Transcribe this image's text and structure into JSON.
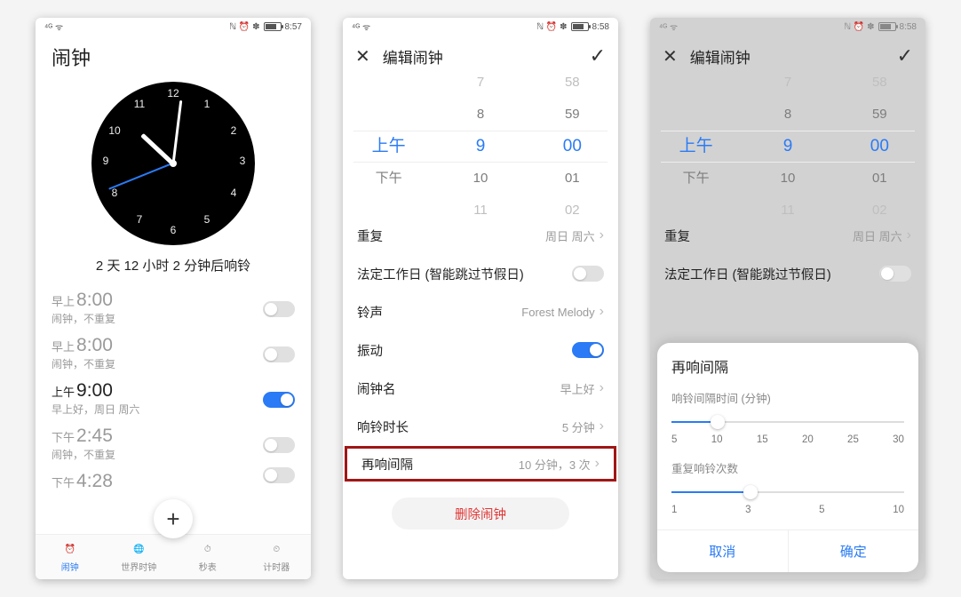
{
  "status": {
    "left": "⁴ᴳ ᯤ",
    "icons": "ℕ ⏰ ✽",
    "batt1": "8:57",
    "batt2": "8:58",
    "batt3": "8:58"
  },
  "p1": {
    "title": "闹钟",
    "countdown": "2 天 12 小时 2 分钟后响铃",
    "alarms": [
      {
        "prefix": "早上",
        "time": "8:00",
        "sub": "闹钟，不重复",
        "on": false
      },
      {
        "prefix": "早上",
        "time": "8:00",
        "sub": "闹钟，不重复",
        "on": false
      },
      {
        "prefix": "上午",
        "time": "9:00",
        "sub": "早上好，周日 周六",
        "on": true
      },
      {
        "prefix": "下午",
        "time": "2:45",
        "sub": "闹钟，不重复",
        "on": false
      },
      {
        "prefix": "下午",
        "time": "4:28",
        "sub": "",
        "on": false
      }
    ],
    "fab": "+",
    "tabs": [
      {
        "icon": "⏰",
        "label": "闹钟"
      },
      {
        "icon": "🌐",
        "label": "世界时钟"
      },
      {
        "icon": "⏱",
        "label": "秒表"
      },
      {
        "icon": "⏲",
        "label": "计时器"
      }
    ]
  },
  "p2": {
    "title": "编辑闹钟",
    "picker": {
      "ampm": {
        "above": "",
        "sel": "上午",
        "below": "下午"
      },
      "hour": {
        "far": "7",
        "above": "8",
        "sel": "9",
        "below": "10",
        "farbelow": "11"
      },
      "min": {
        "far": "58",
        "above": "59",
        "sel": "00",
        "below": "01",
        "farbelow": "02"
      }
    },
    "rows": {
      "repeat": {
        "label": "重复",
        "val": "周日 周六"
      },
      "workday": {
        "label": "法定工作日 (智能跳过节假日)"
      },
      "ringtone": {
        "label": "铃声",
        "val": "Forest Melody"
      },
      "vibrate": {
        "label": "振动"
      },
      "name": {
        "label": "闹钟名",
        "val": "早上好"
      },
      "duration": {
        "label": "响铃时长",
        "val": "5 分钟"
      },
      "snooze": {
        "label": "再响间隔",
        "val": "10 分钟，3 次"
      }
    },
    "delete": "删除闹钟"
  },
  "p3": {
    "sheet": {
      "title": "再响间隔",
      "interval": {
        "label": "响铃间隔时间 (分钟)",
        "labels": [
          "5",
          "10",
          "15",
          "20",
          "25",
          "30"
        ],
        "pos": 20
      },
      "count": {
        "label": "重复响铃次数",
        "labels": [
          "1",
          "3",
          "5",
          "10"
        ],
        "pos": 34
      },
      "cancel": "取消",
      "ok": "确定"
    }
  }
}
